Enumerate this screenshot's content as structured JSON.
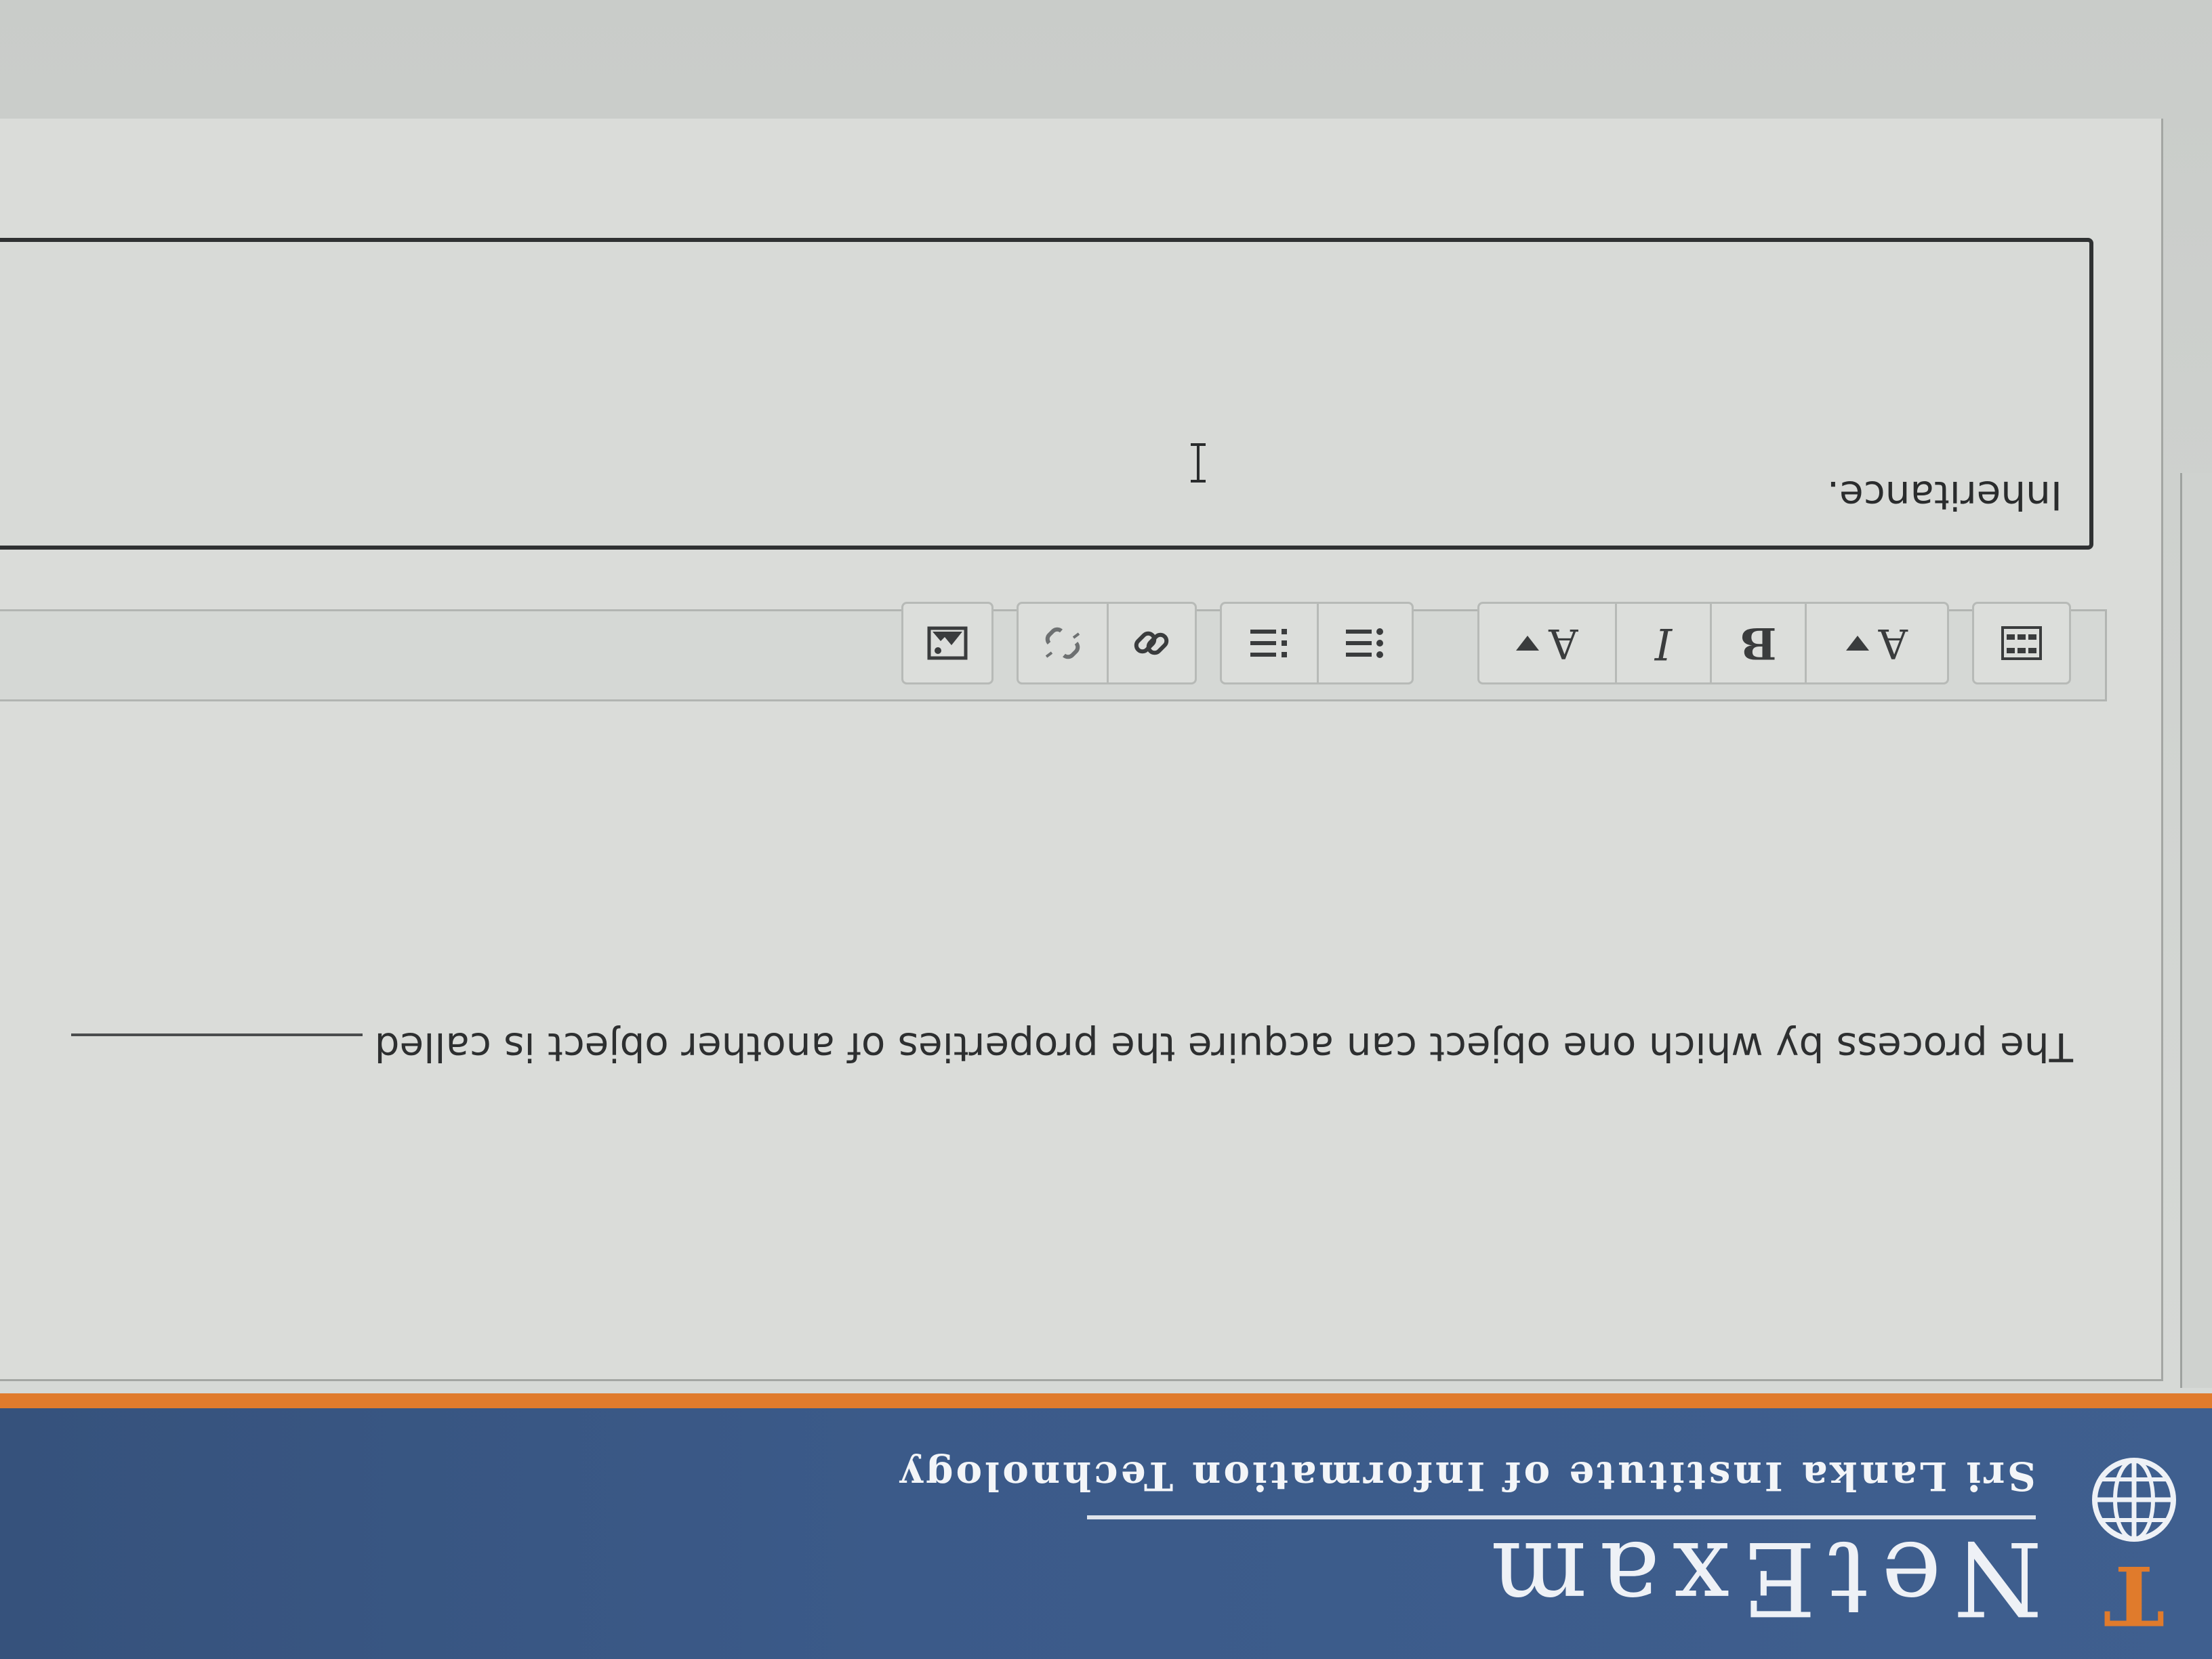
{
  "header": {
    "brand_title": "NetExam",
    "brand_subtitle": "Sri Lanka Institute of Information Technology",
    "logo_letter": "T",
    "colors": {
      "header_bg": "#3b5a89",
      "accent": "#e07b2c"
    }
  },
  "question": {
    "text": "The process by which one object can acquire the properties of another object is called"
  },
  "toolbar": {
    "buttons": [
      {
        "name": "toggle-toolbar-icon",
        "label": ""
      },
      {
        "name": "paragraph-style-icon",
        "label": "A"
      },
      {
        "name": "bold-button",
        "label": "B"
      },
      {
        "name": "italic-button",
        "label": "I"
      },
      {
        "name": "font-color-icon",
        "label": "A"
      },
      {
        "name": "unordered-list-icon",
        "label": ""
      },
      {
        "name": "ordered-list-icon",
        "label": ""
      },
      {
        "name": "link-icon",
        "label": ""
      },
      {
        "name": "unlink-icon",
        "label": ""
      },
      {
        "name": "insert-image-icon",
        "label": ""
      }
    ]
  },
  "answer": {
    "value": "Inheritance."
  }
}
